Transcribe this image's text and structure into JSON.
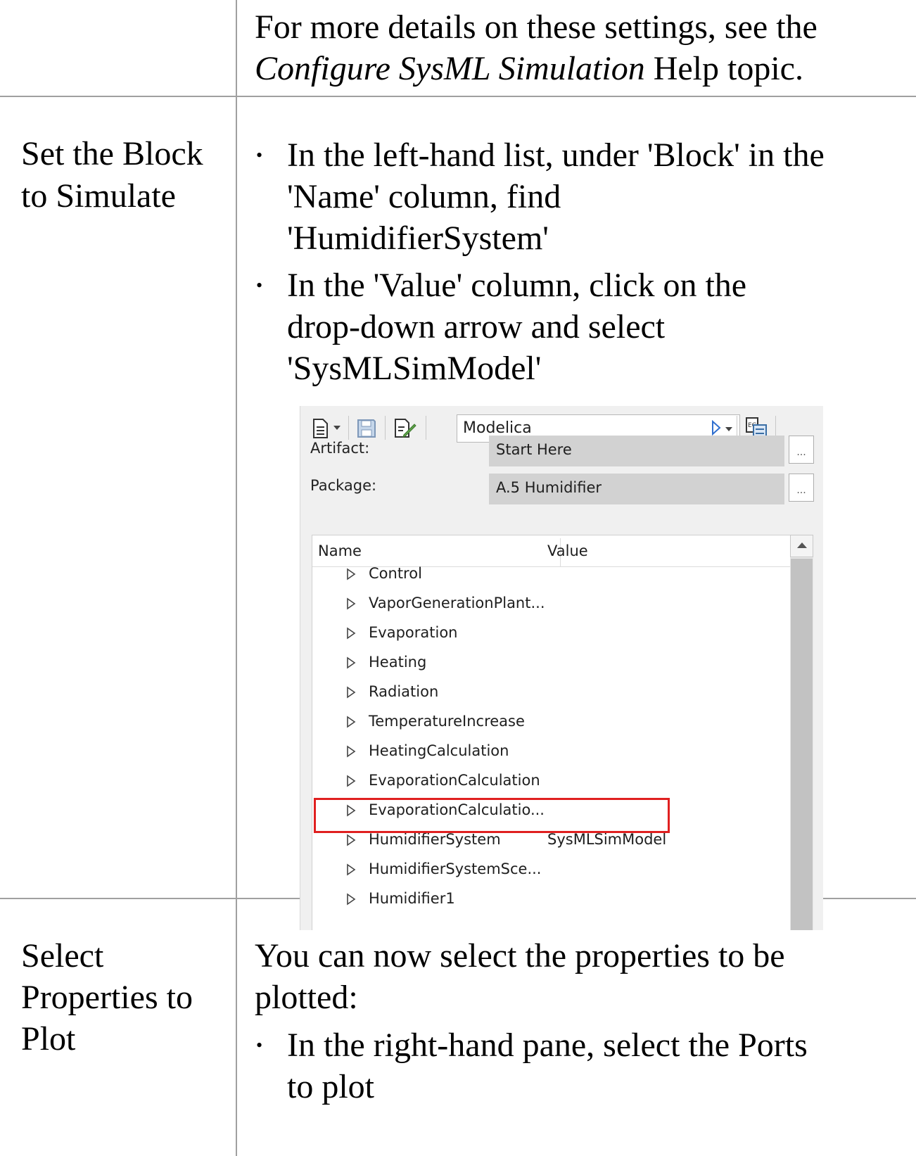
{
  "row1": {
    "line1": "For more details on these settings, see the",
    "line2_italic": "Configure SysML Simulation",
    "line2_rest": " Help topic."
  },
  "row2": {
    "label": [
      "Set the Block",
      "to Simulate"
    ],
    "bullet1": [
      "In the left-hand list, under 'Block' in the",
      "'Name' column, find",
      "'HumidifierSystem'"
    ],
    "bullet2": [
      "In the 'Value' column, click on the",
      "drop-down arrow and select",
      "'SysMLSimModel'"
    ]
  },
  "screenshot": {
    "combo_value": "Modelica",
    "artifact_label": "Artifact:",
    "artifact_value": "Start Here",
    "package_label": "Package:",
    "package_value": "A.5 Humidifier",
    "ellipsis": "...",
    "col_name": "Name",
    "col_value": "Value",
    "rows": [
      {
        "name": "Control",
        "value": ""
      },
      {
        "name": "VaporGenerationPlant...",
        "value": ""
      },
      {
        "name": "Evaporation",
        "value": ""
      },
      {
        "name": "Heating",
        "value": ""
      },
      {
        "name": "Radiation",
        "value": ""
      },
      {
        "name": "TemperatureIncrease",
        "value": ""
      },
      {
        "name": "HeatingCalculation",
        "value": ""
      },
      {
        "name": "EvaporationCalculation",
        "value": ""
      },
      {
        "name": "EvaporationCalculatio...",
        "value": ""
      },
      {
        "name": "HumidifierSystem",
        "value": "SysMLSimModel"
      },
      {
        "name": "HumidifierSystemSce...",
        "value": ""
      },
      {
        "name": "Humidifier1",
        "value": ""
      }
    ]
  },
  "row3": {
    "label": [
      "Select",
      "Properties to",
      "Plot"
    ],
    "intro": [
      "You can now select the properties to be",
      "plotted:"
    ],
    "bullet1": [
      "In the right-hand pane, select the Ports",
      "to plot"
    ]
  },
  "bullet_char": "•"
}
